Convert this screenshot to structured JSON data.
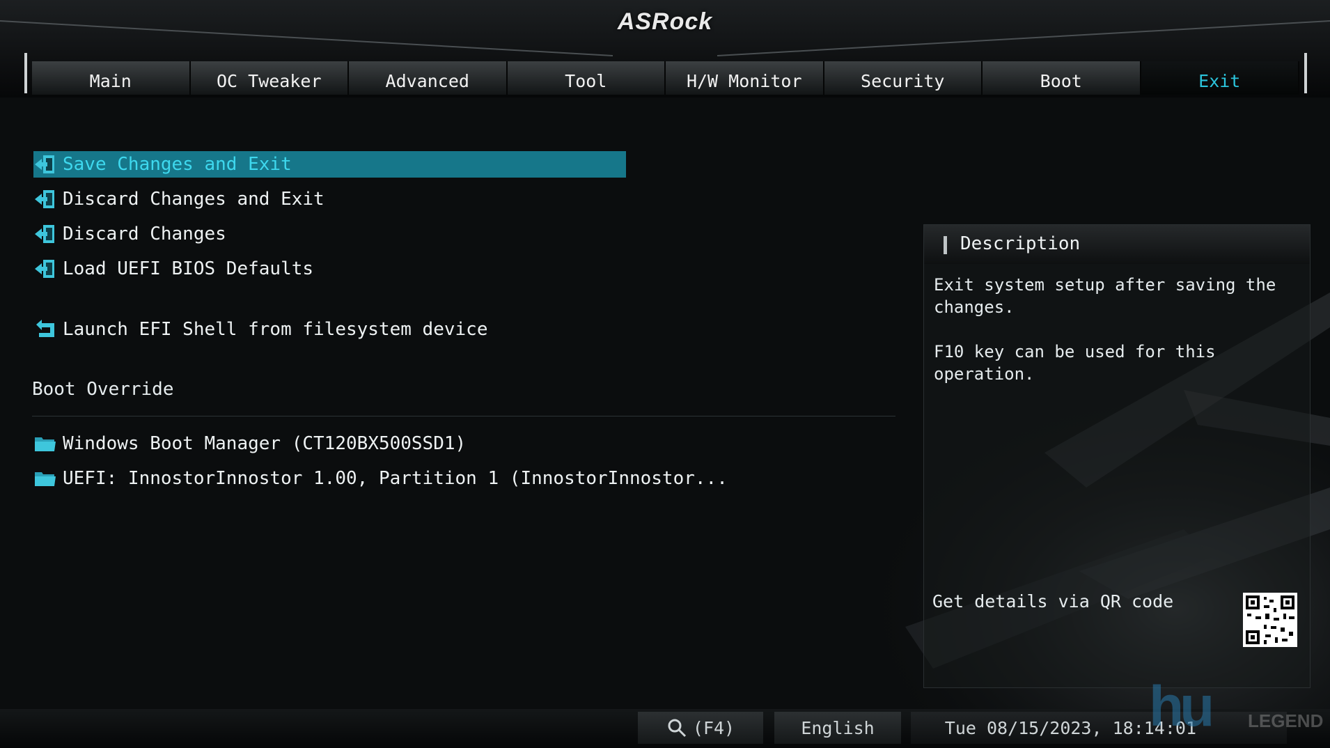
{
  "brand": "ASRock",
  "tabs": [
    {
      "label": "Main",
      "active": false
    },
    {
      "label": "OC Tweaker",
      "active": false
    },
    {
      "label": "Advanced",
      "active": false
    },
    {
      "label": "Tool",
      "active": false
    },
    {
      "label": "H/W Monitor",
      "active": false
    },
    {
      "label": "Security",
      "active": false
    },
    {
      "label": "Boot",
      "active": false
    },
    {
      "label": "Exit",
      "active": true
    }
  ],
  "exit_menu": {
    "items": [
      {
        "label": "Save Changes and Exit",
        "icon": "exit-door-icon",
        "selected": true
      },
      {
        "label": "Discard Changes and Exit",
        "icon": "exit-door-icon",
        "selected": false
      },
      {
        "label": "Discard Changes",
        "icon": "exit-door-icon",
        "selected": false
      },
      {
        "label": "Load UEFI BIOS Defaults",
        "icon": "exit-door-icon",
        "selected": false
      }
    ],
    "efi_shell": {
      "label": "Launch EFI Shell from filesystem device",
      "icon": "launch-arrow-icon"
    },
    "boot_override": {
      "title": "Boot Override",
      "devices": [
        {
          "label": "Windows Boot Manager (CT120BX500SSD1)",
          "icon": "folder-icon"
        },
        {
          "label": "UEFI: InnostorInnostor 1.00, Partition 1 (InnostorInnostor...",
          "icon": "folder-icon"
        }
      ]
    }
  },
  "description": {
    "title": "Description",
    "text": "Exit system setup after saving the\nchanges.\n\nF10 key can be used for this operation.",
    "qr_label": "Get details via QR code"
  },
  "status_bar": {
    "search": "(F4)",
    "language": "English",
    "datetime": "Tue 08/15/2023, 18:14:01"
  },
  "watermark": {
    "text": "hu",
    "sub": "LEGEND"
  },
  "colors": {
    "accent": "#2bc4dc",
    "selection": "#16778a",
    "background": "#0b0d0e"
  }
}
